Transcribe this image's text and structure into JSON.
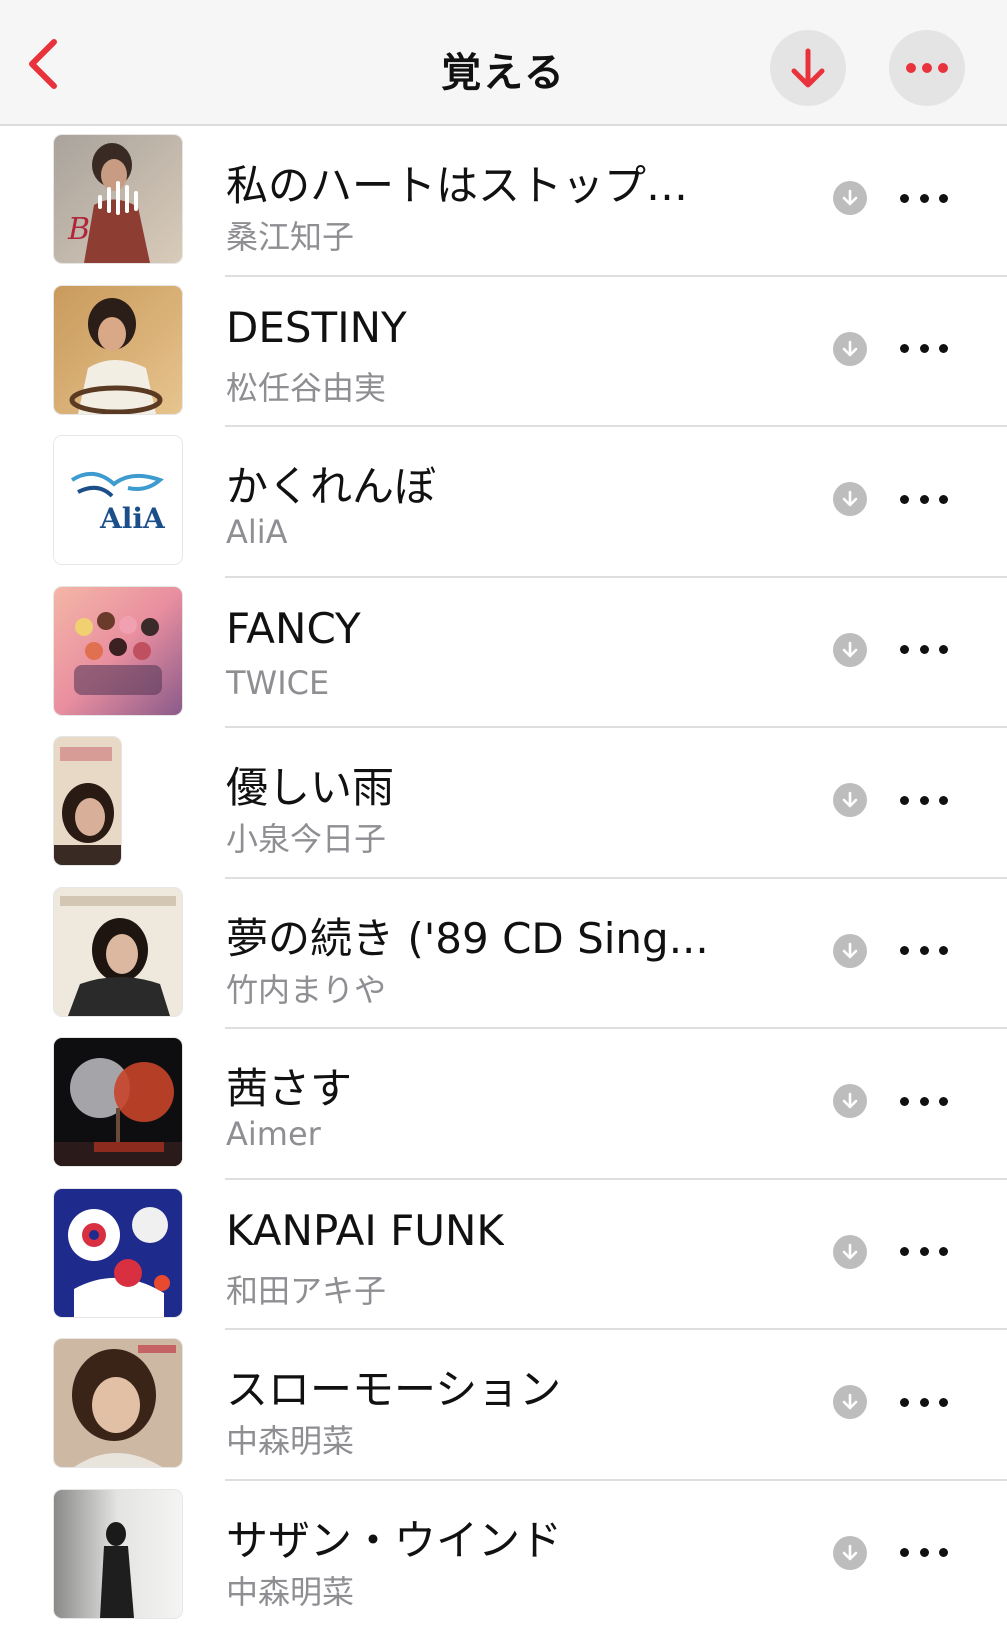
{
  "header": {
    "title": "覚える",
    "accent_color": "#e8323c"
  },
  "songs": [
    {
      "title": "私のハートはストップ…",
      "artist": "桑江知子",
      "art": "art-1",
      "playing": true
    },
    {
      "title": "DESTINY",
      "artist": "松任谷由実",
      "art": "art-2"
    },
    {
      "title": "かくれんぼ",
      "artist": "AliA",
      "art": "art-3",
      "art_logo_text": "AliA"
    },
    {
      "title": "FANCY",
      "artist": "TWICE",
      "art": "art-4"
    },
    {
      "title": "優しい雨",
      "artist": "小泉今日子",
      "art": "art-5"
    },
    {
      "title": "夢の続き ('89 CD Sing...",
      "artist": "竹内まりや",
      "art": "art-6"
    },
    {
      "title": "茜さす",
      "artist": "Aimer",
      "art": "art-7"
    },
    {
      "title": "KANPAI FUNK",
      "artist": "和田アキ子",
      "art": "art-8"
    },
    {
      "title": "スローモーション",
      "artist": "中森明菜",
      "art": "art-9"
    },
    {
      "title": "サザン・ウインド",
      "artist": "中森明菜",
      "art": "art-10"
    }
  ]
}
